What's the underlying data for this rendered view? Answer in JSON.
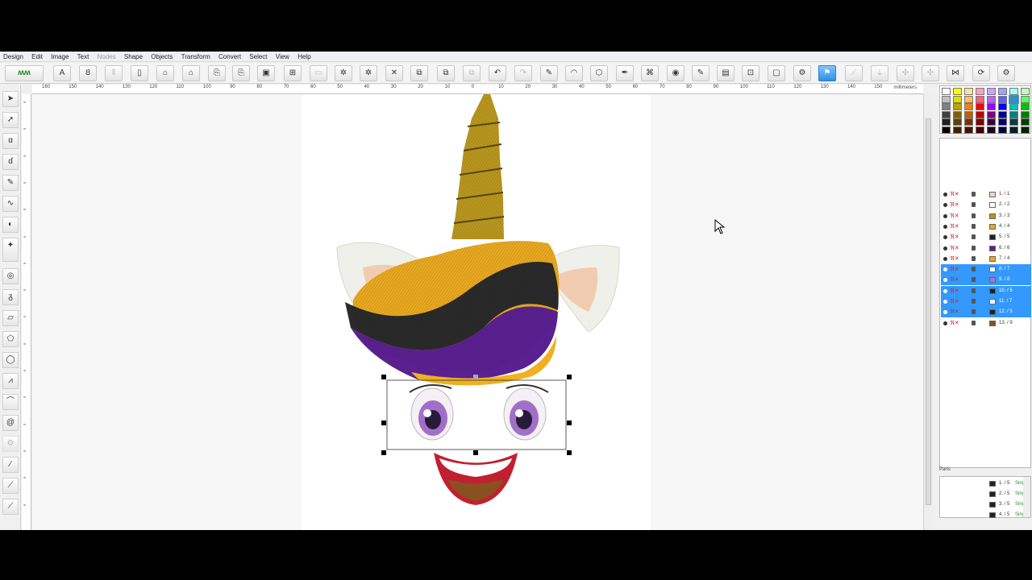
{
  "menu": [
    "Design",
    "Edit",
    "Image",
    "Text",
    "Nodes",
    "Shape",
    "Objects",
    "Transform",
    "Convert",
    "Select",
    "View",
    "Help"
  ],
  "menu_disabled": [
    "Nodes"
  ],
  "ruler": {
    "ticks": [
      "160",
      "150",
      "140",
      "130",
      "120",
      "110",
      "100",
      "90",
      "80",
      "70",
      "60",
      "50",
      "40",
      "30",
      "20",
      "10",
      "0",
      "10",
      "20",
      "30",
      "40",
      "50",
      "60",
      "70",
      "80",
      "90",
      "100",
      "110",
      "120",
      "130",
      "140",
      "150"
    ],
    "unit": "millimeters"
  },
  "palette_colors": [
    "#ffffff",
    "#ffff00",
    "#ffe0a0",
    "#ff9fc0",
    "#d0a0ff",
    "#a0a0ff",
    "#a0ffff",
    "#c0ffc0",
    "#c0c0c0",
    "#e0e000",
    "#ffc060",
    "#ff6080",
    "#c060ff",
    "#6060ff",
    "#2a8fd6",
    "#60ff60",
    "#808080",
    "#c0a000",
    "#ff8000",
    "#ff0000",
    "#a000ff",
    "#0000ff",
    "#00c0c0",
    "#00c000",
    "#404040",
    "#806000",
    "#c06000",
    "#c00000",
    "#800080",
    "#0000a0",
    "#008080",
    "#008000",
    "#202020",
    "#604000",
    "#803000",
    "#800000",
    "#400040",
    "#000080",
    "#004040",
    "#004000",
    "#000000",
    "#402000",
    "#401800",
    "#400000",
    "#200020",
    "#000040",
    "#002020",
    "#002000"
  ],
  "objects": [
    {
      "label": "1. / 1",
      "color": "#f4d6c0",
      "selected": false
    },
    {
      "label": "2. / 2",
      "color": "#ffffff",
      "selected": false
    },
    {
      "label": "3. / 3",
      "color": "#b8961e",
      "selected": false
    },
    {
      "label": "4. / 4",
      "color": "#e8a820",
      "selected": false
    },
    {
      "label": "5. / 5",
      "color": "#222222",
      "selected": false
    },
    {
      "label": "6. / 6",
      "color": "#5a2090",
      "selected": false
    },
    {
      "label": "7. / 4",
      "color": "#e8a820",
      "selected": false
    },
    {
      "label": "8. / 7",
      "color": "#ffffff",
      "selected": true
    },
    {
      "label": "9. / 8",
      "color": "#b070d0",
      "selected": true
    },
    {
      "label": "10. / 5",
      "color": "#222222",
      "selected": true
    },
    {
      "label": "11. / 7",
      "color": "#ffffff",
      "selected": true
    },
    {
      "label": "12. / 5",
      "color": "#222222",
      "selected": true
    },
    {
      "label": "13. / 9",
      "color": "#8a5020",
      "selected": false
    }
  ],
  "parts": {
    "title": "Parts",
    "rows": [
      {
        "label": "1. / 5",
        "type": "Sing"
      },
      {
        "label": "2. / 5",
        "type": "Sing"
      },
      {
        "label": "3. / 5",
        "type": "Sing"
      },
      {
        "label": "4. / 5",
        "type": "Sing"
      }
    ]
  },
  "design_colors": {
    "horn": "#b8961e",
    "hair_gold": "#e8a820",
    "hair_black": "#2a2a2a",
    "hair_purple": "#5a2090",
    "ear": "#f0f0ea",
    "ear_inner": "#f2ccb0",
    "eye": "#a070c8",
    "mouth": "#c02030",
    "selection": "#000000",
    "accent": "#3399ff"
  }
}
